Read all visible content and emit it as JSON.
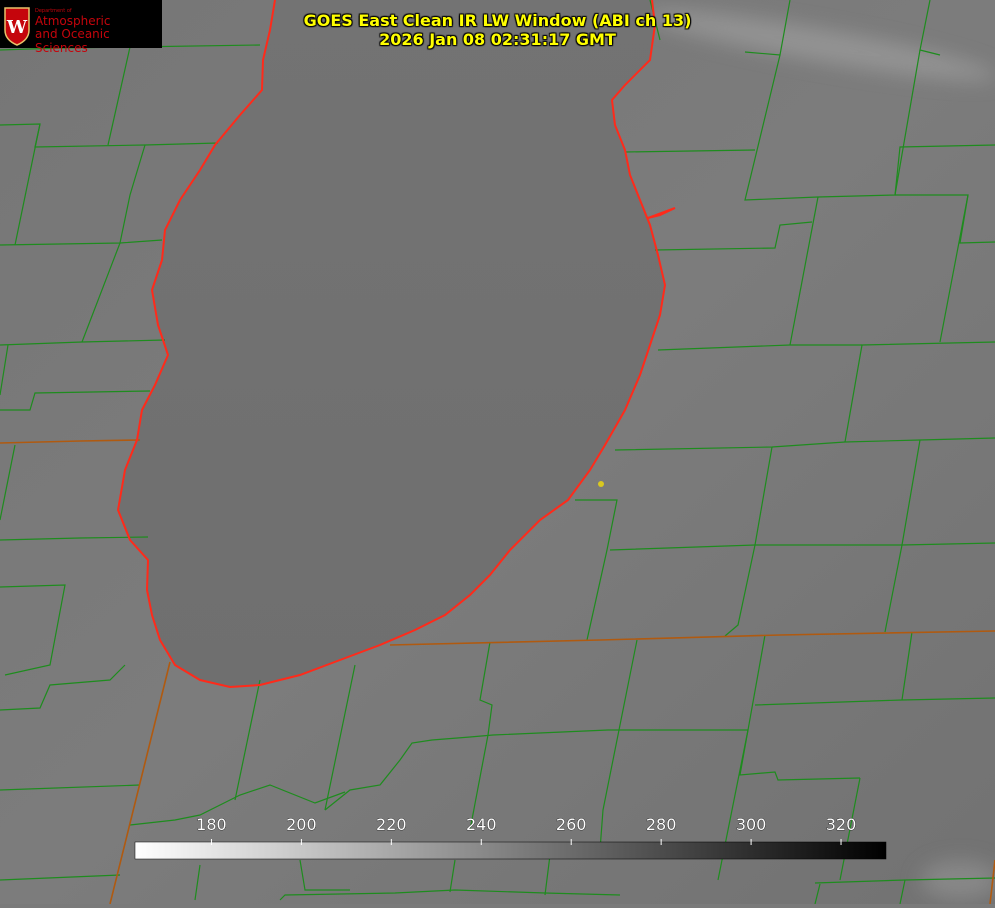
{
  "logo": {
    "dept_label": "Department of",
    "line1": "Atmospheric",
    "line2": "and Oceanic Sciences",
    "seal_letter": "W",
    "seal_color": "#c5050c"
  },
  "title": {
    "line1": "GOES East Clean IR LW Window (ABI ch 13)",
    "line2": "2026 Jan 08 02:31:17 GMT",
    "color": "#ffff00"
  },
  "colorbar": {
    "ticks": [
      "180",
      "200",
      "220",
      "240",
      "260",
      "280",
      "300",
      "320"
    ],
    "min": 163,
    "max": 330,
    "low_color": "#ffffff",
    "high_color": "#000000"
  },
  "map": {
    "shoreline_color": "#ff2a1a",
    "county_border_color": "#1e8c1e",
    "state_border_color": "#b05a10",
    "marker_color": "#d9c820"
  }
}
